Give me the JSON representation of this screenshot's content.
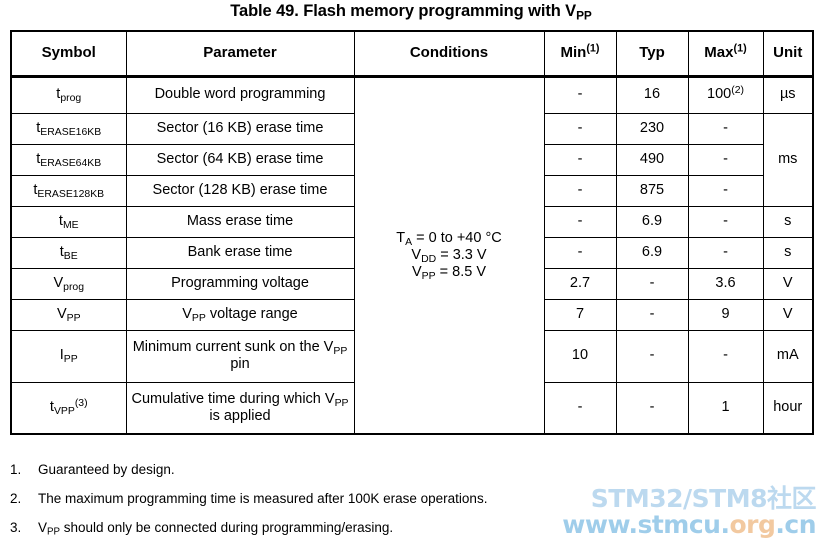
{
  "title": {
    "prefix": "Table 49. Flash memory programming with V",
    "subscript": "PP"
  },
  "table": {
    "headers": {
      "symbol": "Symbol",
      "parameter": "Parameter",
      "conditions": "Conditions",
      "min": "Min",
      "min_note": "(1)",
      "typ": "Typ",
      "max": "Max",
      "max_note": "(1)",
      "unit": "Unit"
    },
    "conditions_block": {
      "line1_a": "T",
      "line1_sub": "A",
      "line1_b": " = 0 to +40 °C",
      "line2_a": "V",
      "line2_sub": "DD",
      "line2_b": " = 3.3 V",
      "line3_a": "V",
      "line3_sub": "PP",
      "line3_b": " = 8.5 V"
    },
    "rows": [
      {
        "symbol_base": "t",
        "symbol_sub": "prog",
        "symbol_sup": "",
        "parameter": "Double word programming",
        "min": "-",
        "typ": "16",
        "max": "100",
        "max_note": "(2)",
        "unit": "µs"
      },
      {
        "symbol_base": "t",
        "symbol_sub": "ERASE16KB",
        "symbol_sup": "",
        "parameter": "Sector (16 KB) erase time",
        "min": "-",
        "typ": "230",
        "max": "-",
        "max_note": "",
        "unit": "ms"
      },
      {
        "symbol_base": "t",
        "symbol_sub": "ERASE64KB",
        "symbol_sup": "",
        "parameter": "Sector (64 KB) erase time",
        "min": "-",
        "typ": "490",
        "max": "-",
        "max_note": "",
        "unit": ""
      },
      {
        "symbol_base": "t",
        "symbol_sub": "ERASE128KB",
        "symbol_sup": "",
        "parameter": "Sector (128 KB) erase time",
        "min": "-",
        "typ": "875",
        "max": "-",
        "max_note": "",
        "unit": ""
      },
      {
        "symbol_base": "t",
        "symbol_sub": "ME",
        "symbol_sup": "",
        "parameter": "Mass erase time",
        "min": "-",
        "typ": "6.9",
        "max": "-",
        "max_note": "",
        "unit": "s"
      },
      {
        "symbol_base": "t",
        "symbol_sub": "BE",
        "symbol_sup": "",
        "parameter": "Bank erase time",
        "min": "-",
        "typ": "6.9",
        "max": "-",
        "max_note": "",
        "unit": "s"
      },
      {
        "symbol_base": "V",
        "symbol_sub": "prog",
        "symbol_sup": "",
        "parameter": "Programming voltage",
        "min": "2.7",
        "typ": "-",
        "max": "3.6",
        "max_note": "",
        "unit": "V"
      },
      {
        "symbol_base": "V",
        "symbol_sub": "PP",
        "symbol_sup": "",
        "parameter": "V|PP| voltage range",
        "min": "7",
        "typ": "-",
        "max": "9",
        "max_note": "",
        "unit": "V"
      },
      {
        "symbol_base": "I",
        "symbol_sub": "PP",
        "symbol_sup": "",
        "parameter": "Minimum current sunk on the V|PP| pin",
        "min": "10",
        "typ": "-",
        "max": "-",
        "max_note": "",
        "unit": "mA"
      },
      {
        "symbol_base": "t",
        "symbol_sub": "VPP",
        "symbol_sup": "(3)",
        "parameter": "Cumulative time during which V|PP| is applied",
        "min": "-",
        "typ": "-",
        "max": "1",
        "max_note": "",
        "unit": "hour"
      }
    ]
  },
  "footnotes": [
    {
      "num": "1.",
      "text": "Guaranteed by design."
    },
    {
      "num": "2.",
      "text": "The maximum programming time is measured after 100K erase operations."
    },
    {
      "num": "3.",
      "text": "V|PP| should only be connected during programming/erasing."
    }
  ],
  "watermark": {
    "line1": "STM32/STM8社区",
    "line2_pre": "www.stmcu.",
    "line2_org": "org",
    "line2_post": ".cn",
    "color_line1": "#bcd9ef",
    "color_line2": "#9fcdea",
    "color_org": "#f2c9a0"
  }
}
